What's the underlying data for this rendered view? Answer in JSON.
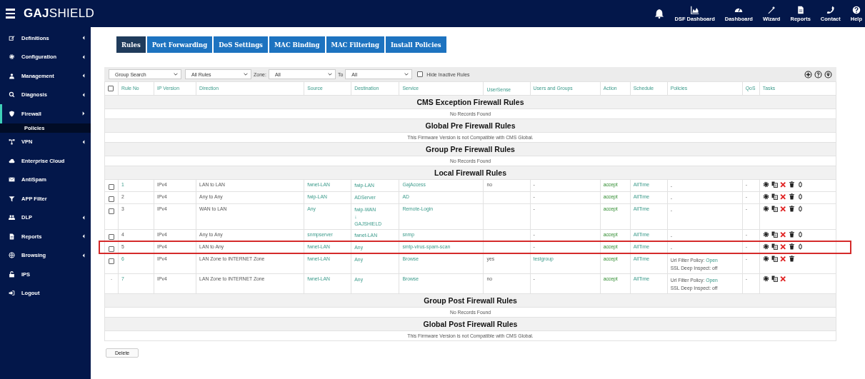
{
  "brand": {
    "bold": "GAJ",
    "rest": "SHIELD"
  },
  "top_nav": [
    {
      "label": "DSF Dashboard"
    },
    {
      "label": "Dashboard"
    },
    {
      "label": "Wizard"
    },
    {
      "label": "Reports"
    },
    {
      "label": "Contact"
    },
    {
      "label": "Help"
    }
  ],
  "sidebar": {
    "items": [
      {
        "label": "Definitions",
        "expandable": true,
        "active": false
      },
      {
        "label": "Configuration",
        "expandable": true,
        "active": false
      },
      {
        "label": "Management",
        "expandable": true,
        "active": false
      },
      {
        "label": "Diagnosis",
        "expandable": true,
        "active": false
      },
      {
        "label": "Firewall",
        "expandable": true,
        "active": true,
        "expanded": true,
        "children": [
          {
            "label": "Policies",
            "selected": true
          }
        ]
      },
      {
        "label": "VPN",
        "expandable": true,
        "active": false
      },
      {
        "label": "Enterprise Cloud",
        "expandable": false,
        "active": false
      },
      {
        "label": "AntiSpam",
        "expandable": false,
        "active": false
      },
      {
        "label": "APP Filter",
        "expandable": false,
        "active": false
      },
      {
        "label": "DLP",
        "expandable": true,
        "active": false
      },
      {
        "label": "Reports",
        "expandable": true,
        "active": false
      },
      {
        "label": "Browsing",
        "expandable": true,
        "active": false
      },
      {
        "label": "IPS",
        "expandable": false,
        "active": false
      },
      {
        "label": "Logout",
        "expandable": false,
        "active": false
      }
    ]
  },
  "tabs": [
    {
      "label": "Rules",
      "selected": true
    },
    {
      "label": "Port Forwarding",
      "selected": false
    },
    {
      "label": "DoS Settings",
      "selected": false
    },
    {
      "label": "MAC Binding",
      "selected": false
    },
    {
      "label": "MAC Filtering",
      "selected": false
    },
    {
      "label": "Install Policies",
      "selected": false
    }
  ],
  "filters": {
    "group": "Group Search",
    "rules": "All Rules",
    "zone_label": "Zone:",
    "zone": "All",
    "to_label": "To",
    "to": "All",
    "hide_inactive": {
      "label": "Hide Inactive Rules",
      "checked": false
    }
  },
  "table": {
    "select_all": {
      "checked": false
    },
    "columns": [
      "Rule No",
      "IP Version",
      "Direction",
      "Source",
      "Destination",
      "Service",
      "UserSense",
      "Users and Groups",
      "Action",
      "Schedule",
      "Policies",
      "QoS",
      "Tasks"
    ],
    "sections": [
      {
        "title": "CMS Exception Firewall Rules",
        "message": "No Records Found"
      },
      {
        "title": "Global Pre Firewall Rules",
        "message": "This Firmware Version is not Compatible with CMS Global."
      },
      {
        "title": "Group Pre Firewall Rules",
        "message": "No Records Found"
      },
      {
        "title": "Local Firewall Rules",
        "rows": [
          {
            "kind": "checkbox",
            "checked": false,
            "highlighted": false,
            "rule_no": "1",
            "rule_link": true,
            "ip": "IPv4",
            "direction": "LAN to LAN",
            "source": "fwnet-LAN",
            "destination": [
              "fwip-LAN"
            ],
            "service": "GajAccess",
            "usersense": "no",
            "users": "-",
            "action": "accept",
            "schedule": "AllTime",
            "policies": [
              {
                "text": "-"
              }
            ],
            "qos": "-",
            "tasks": [
              {
                "kind": "settings"
              },
              {
                "kind": "copy"
              },
              {
                "kind": "delete"
              },
              {
                "kind": "trash"
              },
              {
                "kind": "toggle"
              }
            ]
          },
          {
            "kind": "checkbox",
            "checked": false,
            "highlighted": false,
            "rule_no": "2",
            "rule_link": false,
            "ip": "IPv4",
            "direction": "Any to Any",
            "source": "fwip-LAN",
            "destination": [
              "ADServer"
            ],
            "service": "AD",
            "users": "-",
            "action": "accept",
            "schedule": "AllTime",
            "policies": [
              {
                "text": "-"
              }
            ],
            "qos": "-",
            "tasks": [
              {
                "kind": "settings"
              },
              {
                "kind": "copy"
              },
              {
                "kind": "delete"
              },
              {
                "kind": "trash"
              },
              {
                "kind": "toggle"
              }
            ]
          },
          {
            "kind": "checkbox",
            "checked": false,
            "highlighted": false,
            "rule_no": "3",
            "rule_link": false,
            "ip": "IPv4",
            "direction": "WAN to LAN",
            "source": "Any",
            "destination": [
              "fwip-WAN",
              "↓",
              "GAJSHIELD"
            ],
            "service": "Remote-Login",
            "users": "-",
            "action": "accept",
            "schedule": "AllTime",
            "policies": [
              {
                "text": "-"
              }
            ],
            "qos": "-",
            "tasks": [
              {
                "kind": "settings"
              },
              {
                "kind": "copy"
              },
              {
                "kind": "delete"
              },
              {
                "kind": "trash"
              },
              {
                "kind": "toggle"
              }
            ]
          },
          {
            "kind": "checkbox",
            "checked": false,
            "highlighted": false,
            "rule_no": "4",
            "rule_link": false,
            "ip": "IPv4",
            "direction": "Any to Any",
            "source": "snmpserver",
            "destination": [
              "fwnet-LAN"
            ],
            "service": "snmp",
            "users": "-",
            "action": "accept",
            "schedule": "AllTime",
            "policies": [
              {
                "text": "-"
              }
            ],
            "qos": "-",
            "tasks": [
              {
                "kind": "settings"
              },
              {
                "kind": "copy"
              },
              {
                "kind": "delete"
              },
              {
                "kind": "trash"
              },
              {
                "kind": "toggle"
              }
            ]
          },
          {
            "kind": "checkbox",
            "checked": false,
            "highlighted": true,
            "rule_no": "5",
            "rule_link": false,
            "ip": "IPv4",
            "direction": "LAN to Any",
            "source": "fwnet-LAN",
            "destination": [
              "Any"
            ],
            "service": "smtp-virus-spam-scan",
            "users": "-",
            "action": "accept",
            "schedule": "AllTime",
            "policies": [
              {
                "text": "-"
              }
            ],
            "qos": "-",
            "tasks": [
              {
                "kind": "settings"
              },
              {
                "kind": "copy"
              },
              {
                "kind": "delete"
              },
              {
                "kind": "trash"
              },
              {
                "kind": "toggle"
              }
            ]
          },
          {
            "kind": "checkbox",
            "checked": false,
            "highlighted": false,
            "rule_no": "6",
            "rule_link": true,
            "ip": "IPv4",
            "direction": "LAN Zone to INTERNET Zone",
            "source": "fwnet-LAN",
            "destination": [
              "Any"
            ],
            "service": "Browse",
            "usersense": "yes",
            "users": "testgroup",
            "users_link": true,
            "action": "accept",
            "schedule": "AllTime",
            "policies": [
              {
                "text": "Url Filter Policy:",
                "link": "Open"
              },
              {
                "text": "SSL Deep Inspect: off"
              }
            ],
            "qos": "-",
            "tasks": [
              {
                "kind": "settings"
              },
              {
                "kind": "copy"
              },
              {
                "kind": "delete"
              },
              {
                "kind": "trash"
              }
            ]
          },
          {
            "kind": "dash",
            "mark": "-",
            "highlighted": false,
            "rule_no": "7",
            "rule_link": true,
            "ip": "IPv4",
            "direction": "LAN Zone to INTERNET Zone",
            "source": "fwnet-LAN",
            "destination": [
              "Any"
            ],
            "service": "Browse",
            "usersense": "no",
            "users": "-",
            "action": "accept",
            "schedule": "AllTime",
            "policies": [
              {
                "text": "Url Filter Policy:",
                "link": "Open"
              },
              {
                "text": "SSL Deep Inspect: off"
              }
            ],
            "qos": "-",
            "tasks": [
              {
                "kind": "settings"
              },
              {
                "kind": "copy"
              },
              {
                "kind": "delete"
              }
            ]
          }
        ]
      },
      {
        "title": "Group Post Firewall Rules",
        "message": "No Records Found"
      },
      {
        "title": "Global Post Firewall Rules",
        "message": "This Firmware Version is not Compatible with CMS Global."
      }
    ]
  },
  "delete_button": "Delete"
}
